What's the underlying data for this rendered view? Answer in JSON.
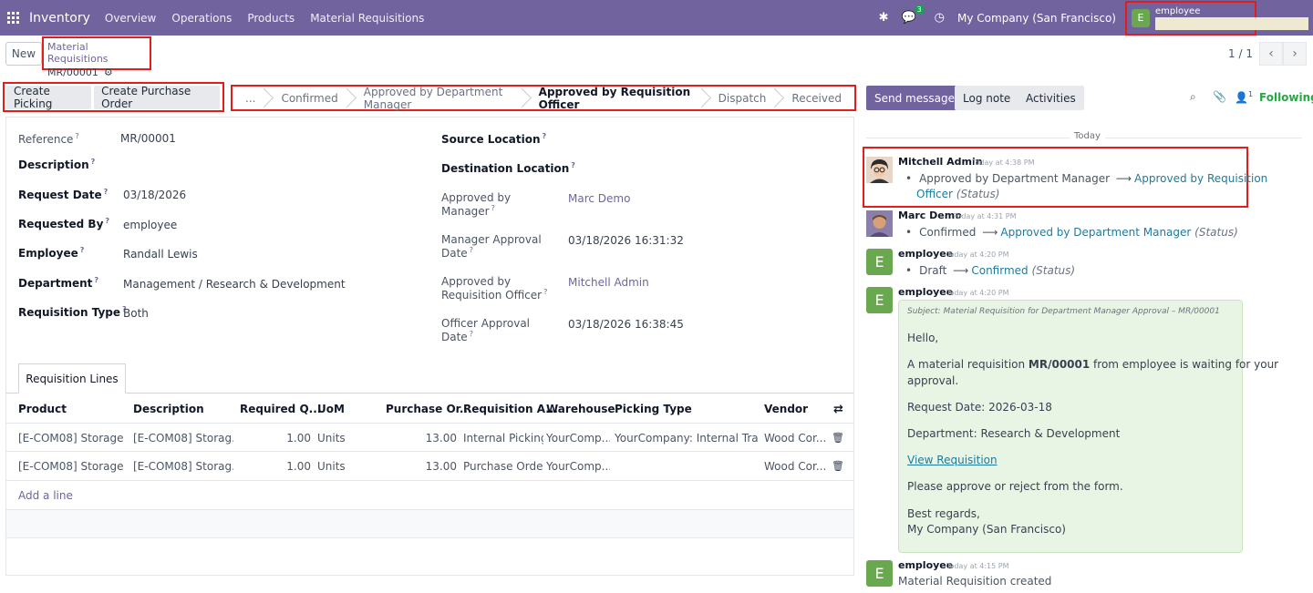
{
  "navbar": {
    "app_name": "Inventory",
    "menu": [
      "Overview",
      "Operations",
      "Products",
      "Material Requisitions"
    ],
    "message_count": "3",
    "company": "My Company (San Francisco)",
    "user_initial": "E",
    "user_name": "employee"
  },
  "control": {
    "new_label": "New",
    "breadcrumb_parent": "Material Requisitions",
    "record_name": "MR/00001",
    "pager": "1 / 1"
  },
  "actions": {
    "create_picking": "Create Picking",
    "create_purchase_order": "Create Purchase Order"
  },
  "statusbar": {
    "stages": [
      "...",
      "Confirmed",
      "Approved by Department Manager",
      "Approved by Requisition Officer",
      "Dispatch",
      "Received"
    ],
    "active_index": 3
  },
  "form": {
    "reference_label": "Reference",
    "reference": "MR/00001",
    "description_label": "Description",
    "request_date_label": "Request Date",
    "request_date": "03/18/2026",
    "requested_by_label": "Requested By",
    "requested_by": "employee",
    "employee_label": "Employee",
    "employee": "Randall Lewis",
    "department_label": "Department",
    "department": "Management / Research & Development",
    "requisition_type_label": "Requisition Type",
    "requisition_type": "Both",
    "source_location_label": "Source Location",
    "destination_location_label": "Destination Location",
    "approved_by_manager_label_1": "Approved by",
    "approved_by_manager_label_2": "Manager",
    "approved_by_manager": "Marc Demo",
    "manager_approval_date_label_1": "Manager Approval",
    "manager_approval_date_label_2": "Date",
    "manager_approval_date": "03/18/2026 16:31:32",
    "approved_by_officer_label_1": "Approved by",
    "approved_by_officer_label_2": "Requisition Officer",
    "approved_by_officer": "Mitchell Admin",
    "officer_approval_date_label_1": "Officer Approval",
    "officer_approval_date_label_2": "Date",
    "officer_approval_date": "03/18/2026 16:38:45",
    "help_mark": "?"
  },
  "lines": {
    "tab": "Requisition Lines",
    "headers": [
      "Product",
      "Description",
      "Required Q...",
      "UoM",
      "Purchase Or...",
      "Requisition A...",
      "Warehouse",
      "Picking Type",
      "Vendor"
    ],
    "rows": [
      [
        "[E-COM08] Storage ...",
        "[E-COM08] Storag...",
        "1.00",
        "Units",
        "13.00",
        "Internal Picking",
        "YourComp...",
        "YourCompany: Internal Tra...",
        "Wood Cor..."
      ],
      [
        "[E-COM08] Storage ...",
        "[E-COM08] Storag...",
        "1.00",
        "Units",
        "13.00",
        "Purchase Order",
        "YourComp...",
        "",
        "Wood Cor..."
      ]
    ],
    "add_line": "Add a line"
  },
  "chatter": {
    "send_message": "Send message",
    "log_note": "Log note",
    "activities": "Activities",
    "followers_count": "1",
    "following": "Following",
    "today": "Today",
    "messages": [
      {
        "author": "Mitchell Admin",
        "time": "Today at 4:38 PM",
        "from": "Approved by Department Manager",
        "to_1": "Approved by Requisition",
        "to_2": "Officer",
        "field": "(Status)"
      },
      {
        "author": "Marc Demo",
        "time": "Today at 4:31 PM",
        "from": "Confirmed",
        "to": "Approved by Department Manager",
        "field": "(Status)"
      },
      {
        "author": "employee",
        "time": "Today at 4:20 PM",
        "from": "Draft",
        "to": "Confirmed",
        "field": "(Status)"
      },
      {
        "author": "employee",
        "time": "Today at 4:20 PM"
      },
      {
        "author": "employee",
        "time": "Today at 4:15 PM",
        "body": "Material Requisition created"
      }
    ],
    "email": {
      "subject": "Subject: Material Requisition for Department Manager Approval – MR/00001",
      "hello": "Hello,",
      "line1_a": "A material requisition ",
      "line1_b": "MR/00001",
      "line1_c": " from employee is waiting for your",
      "line1_d": "approval.",
      "request_date": "Request Date: 2026-03-18",
      "department": "Department: Research & Development",
      "view_link": "View Requisition",
      "please": "Please approve or reject from the form.",
      "regards": "Best regards,",
      "company": "My Company (San Francisco)"
    }
  },
  "colors": {
    "brand": "#71639e",
    "highlight": "#e31c1c",
    "success": "#28a745",
    "mail_bg": "#e8f5e4"
  }
}
